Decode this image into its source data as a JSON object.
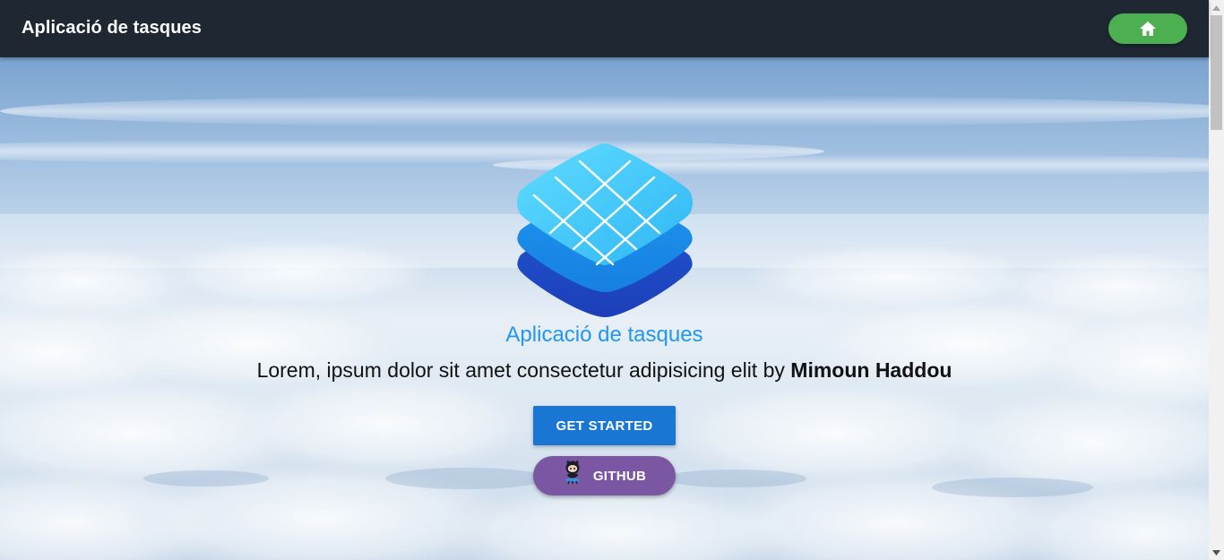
{
  "header": {
    "title": "Aplicació de tasques",
    "home_icon": "home-icon"
  },
  "hero": {
    "logo_icon": "layered-grid-logo-icon",
    "title": "Aplicació de tasques",
    "text": "Lorem, ipsum dolor sit amet consectetur adipisicing elit by",
    "author": "Mimoun Haddou",
    "get_started_label": "GET STARTED",
    "github_label": "GITHUB",
    "github_icon": "octocat-icon"
  },
  "colors": {
    "header_bg": "#1f2733",
    "home_button": "#4caf50",
    "title_accent": "#2196f3",
    "primary_button": "#1976d2",
    "github_button": "#7b57a3"
  }
}
